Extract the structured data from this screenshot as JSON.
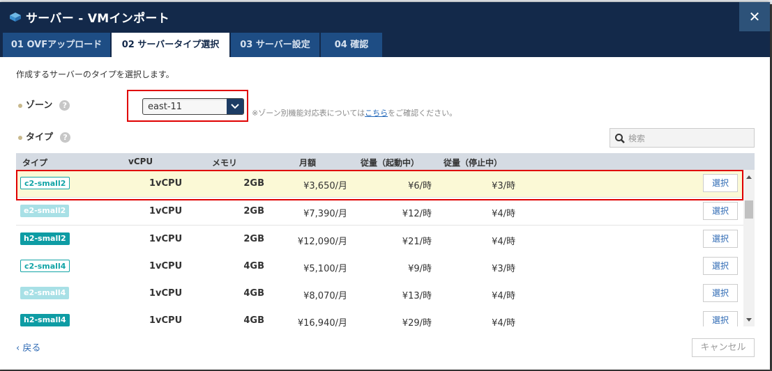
{
  "dialog": {
    "title": "サーバー - VMインポート",
    "close_label": "✕"
  },
  "tabs": [
    {
      "label": "01 OVFアップロード",
      "active": false
    },
    {
      "label": "02 サーバータイプ選択",
      "active": true
    },
    {
      "label": "03 サーバー設定",
      "active": false
    },
    {
      "label": "04 確認",
      "active": false
    }
  ],
  "intro": "作成するサーバーのタイプを選択します。",
  "zone": {
    "label": "ゾーン",
    "help": "?",
    "value": "east-11",
    "note_prefix": "※ゾーン別機能対応表については",
    "note_link": "こちら",
    "note_suffix": "をご確認ください。"
  },
  "type_section": {
    "label": "タイプ",
    "help": "?",
    "search_placeholder": "検索"
  },
  "table": {
    "headers": [
      "タイプ",
      "vCPU",
      "メモリ",
      "月額",
      "従量（起動中）",
      "従量（停止中）"
    ],
    "select_label": "選択",
    "rows": [
      {
        "type": "c2-small2",
        "family": "c2",
        "vcpu": "1vCPU",
        "memory": "2GB",
        "monthly": "¥3,650/月",
        "running": "¥6/時",
        "stopped": "¥3/時",
        "selected": true
      },
      {
        "type": "e2-small2",
        "family": "e2",
        "vcpu": "1vCPU",
        "memory": "2GB",
        "monthly": "¥7,390/月",
        "running": "¥12/時",
        "stopped": "¥4/時",
        "selected": false
      },
      {
        "type": "h2-small2",
        "family": "h2",
        "vcpu": "1vCPU",
        "memory": "2GB",
        "monthly": "¥12,090/月",
        "running": "¥21/時",
        "stopped": "¥4/時",
        "selected": false
      },
      {
        "type": "c2-small4",
        "family": "c2",
        "vcpu": "1vCPU",
        "memory": "4GB",
        "monthly": "¥5,100/月",
        "running": "¥9/時",
        "stopped": "¥3/時",
        "selected": false
      },
      {
        "type": "e2-small4",
        "family": "e2",
        "vcpu": "1vCPU",
        "memory": "4GB",
        "monthly": "¥8,070/月",
        "running": "¥13/時",
        "stopped": "¥4/時",
        "selected": false
      },
      {
        "type": "h2-small4",
        "family": "h2",
        "vcpu": "1vCPU",
        "memory": "4GB",
        "monthly": "¥16,940/月",
        "running": "¥29/時",
        "stopped": "¥4/時",
        "selected": false
      }
    ]
  },
  "footer": {
    "back_label": "‹ 戻る",
    "cancel_label": "キャンセル"
  },
  "colors": {
    "header_bg": "#13294a",
    "tab_bg": "#1e4d84",
    "accent_link": "#2f6ab4",
    "highlight_border": "#e00000",
    "c2_badge": "#12a4a6",
    "e2_badge": "#a8e0e6",
    "h2_badge": "#0e9ca4"
  }
}
